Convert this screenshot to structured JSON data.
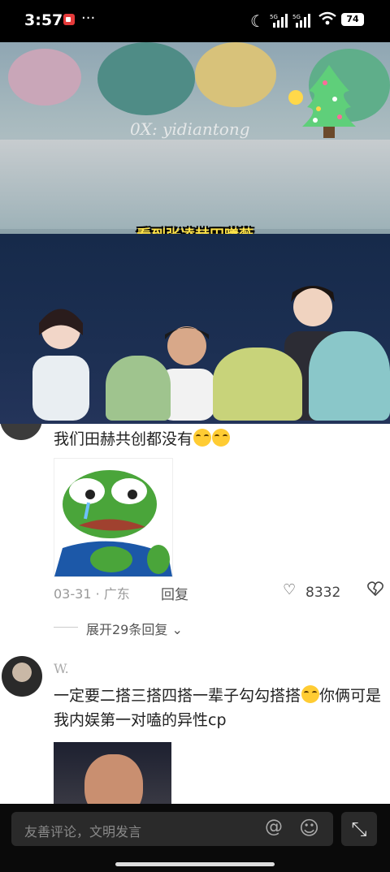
{
  "status_bar": {
    "time": "3:57",
    "more": "···",
    "signal1": "5G",
    "signal2": "5G",
    "battery": "74"
  },
  "video": {
    "watermark": "0X: yidiantong",
    "subtitle": "看到张凌赫田曦薇"
  },
  "comments": [
    {
      "text": "我们田赫共创都没有",
      "date_location": "03-31 · 广东",
      "reply_label": "回复",
      "likes": "8332",
      "expand_label": "展开29条回复"
    },
    {
      "username": "W.",
      "text": "一定要二搭三搭四搭一辈子勾勾搭搭",
      "text2": "你俩可是我内娱第一对嗑的异性cp"
    }
  ],
  "input": {
    "placeholder": "友善评论，文明发言"
  },
  "icons": {
    "at": "@",
    "emoji": "☺",
    "expand": "⤡",
    "heart": "♡",
    "broken_heart": "💔"
  }
}
